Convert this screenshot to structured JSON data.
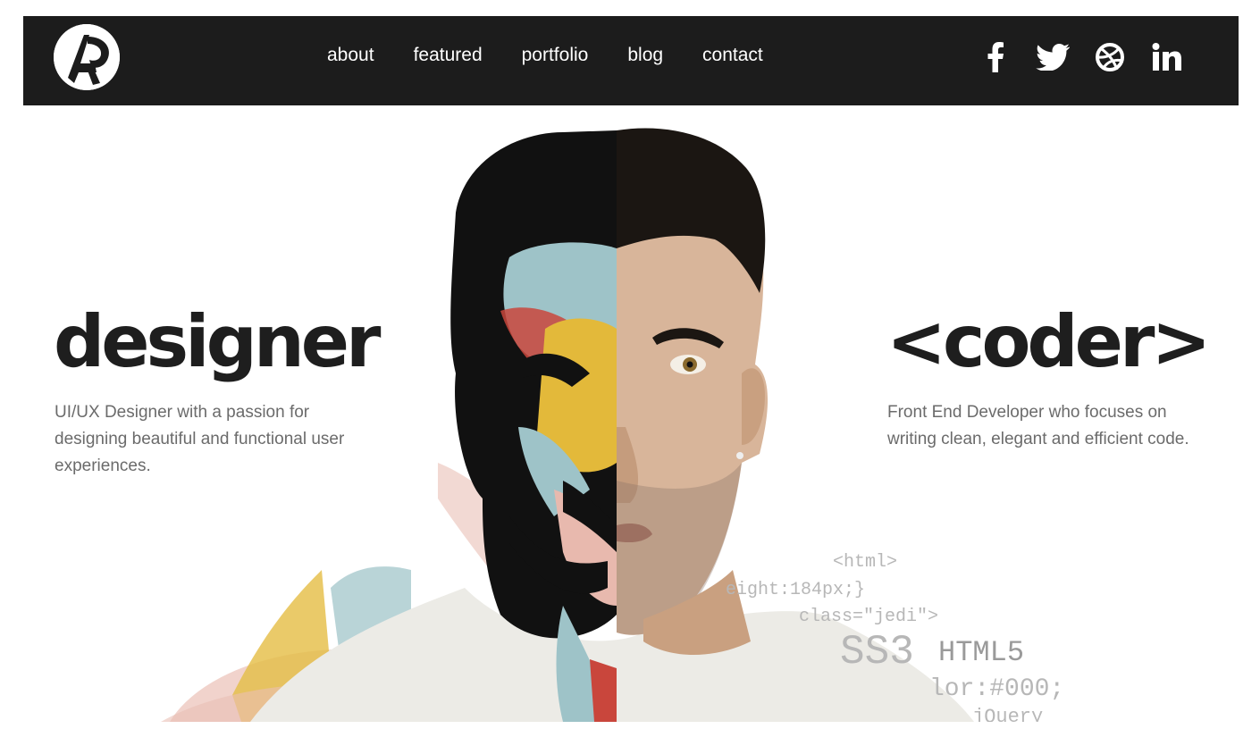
{
  "nav": {
    "logo_name": "AP monogram logo",
    "links": [
      "about",
      "featured",
      "portfolio",
      "blog",
      "contact"
    ],
    "social": [
      "facebook-icon",
      "twitter-icon",
      "dribbble-icon",
      "linkedin-icon"
    ]
  },
  "hero": {
    "left": {
      "title": "designer",
      "description": "UI/UX Designer with a passion for designing beautiful and functional user experiences."
    },
    "right": {
      "title": "<coder>",
      "description": "Front End Developer who focuses on writing clean, elegant and efficient code."
    },
    "code_snippets": [
      "<html>",
      "eight:184px;}",
      "class=\"jedi\">",
      "SS3",
      "HTML5",
      "lor:#000;",
      "jQuery"
    ]
  },
  "colors": {
    "navbar": "#1c1c1c",
    "text_dark": "#1e1e1e",
    "text_muted": "#6b6b6b",
    "paint_blue": "#9ec3c8",
    "paint_yellow": "#e3b93a",
    "paint_red": "#c9463c",
    "paint_pink": "#e8b9ae"
  }
}
